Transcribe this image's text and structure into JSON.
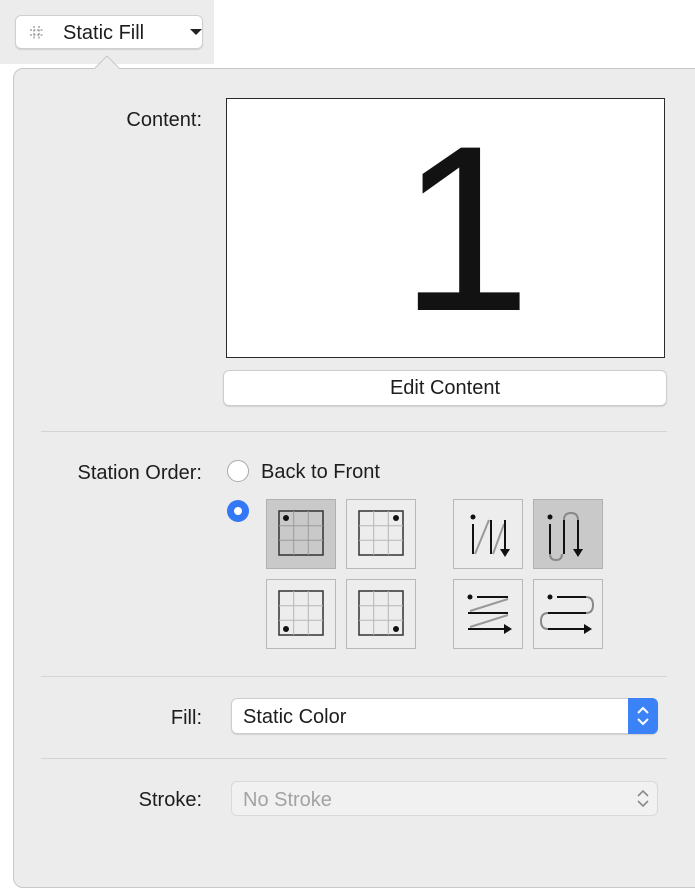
{
  "popup": {
    "label": "Static Fill",
    "icon": "dashed-grid-icon"
  },
  "content": {
    "label": "Content:",
    "preview_text": "1",
    "edit_button": "Edit Content"
  },
  "station_order": {
    "label": "Station Order:",
    "back_to_front": {
      "label": "Back to Front",
      "selected": false
    },
    "custom": {
      "selected": true
    },
    "corners": [
      {
        "name": "top-left",
        "selected": true
      },
      {
        "name": "top-right",
        "selected": false
      },
      {
        "name": "bottom-left",
        "selected": false
      },
      {
        "name": "bottom-right",
        "selected": false
      }
    ],
    "patterns": [
      {
        "name": "vertical-zigzag",
        "selected": false
      },
      {
        "name": "vertical-snake",
        "selected": true
      },
      {
        "name": "horizontal-zigzag",
        "selected": false
      },
      {
        "name": "horizontal-snake",
        "selected": false
      }
    ]
  },
  "fill": {
    "label": "Fill:",
    "value": "Static Color"
  },
  "stroke": {
    "label": "Stroke:",
    "value": "No Stroke",
    "enabled": false
  },
  "colors": {
    "accent": "#3478f6",
    "panel": "#ececec"
  }
}
